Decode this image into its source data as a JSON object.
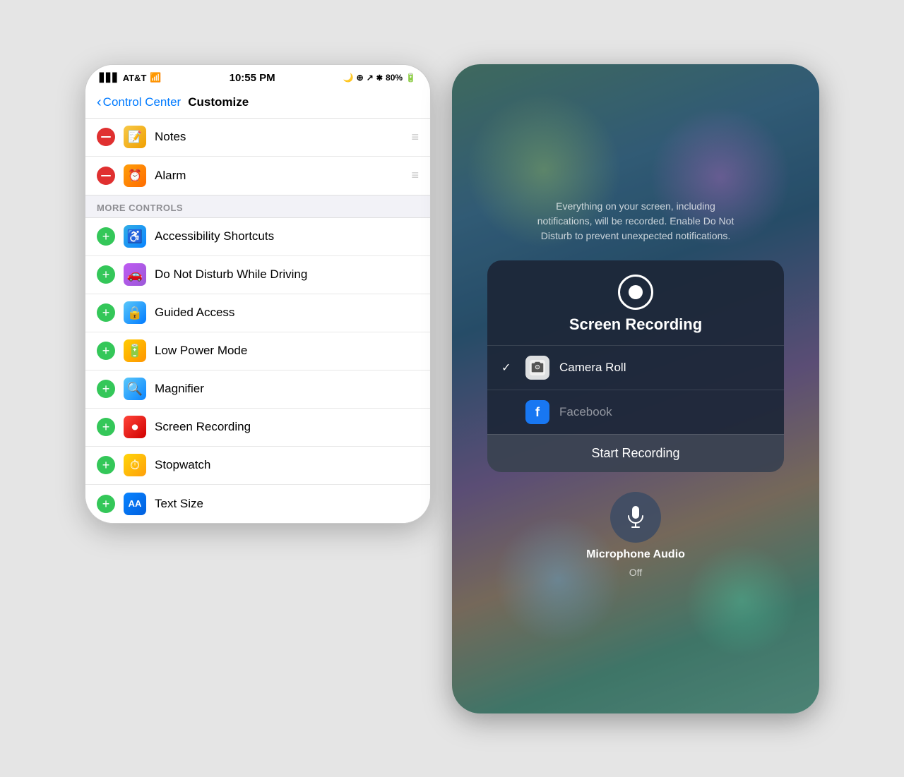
{
  "left_panel": {
    "status_bar": {
      "carrier": "AT&T",
      "time": "10:55 PM",
      "battery": "80%"
    },
    "nav": {
      "back_label": "Control Center",
      "title": "Customize"
    },
    "included_items": [
      {
        "id": "notes",
        "label": "Notes",
        "icon_class": "icon-yellow",
        "icon_char": "📝"
      },
      {
        "id": "alarm",
        "label": "Alarm",
        "icon_class": "icon-orange",
        "icon_char": "⏰"
      }
    ],
    "section_header": "MORE CONTROLS",
    "more_items": [
      {
        "id": "accessibility",
        "label": "Accessibility Shortcuts",
        "icon_class": "icon-blue",
        "icon_char": "♿"
      },
      {
        "id": "dnd-driving",
        "label": "Do Not Disturb While Driving",
        "icon_class": "icon-purple",
        "icon_char": "🚗"
      },
      {
        "id": "guided-access",
        "label": "Guided Access",
        "icon_class": "icon-blue-light",
        "icon_char": "🔒"
      },
      {
        "id": "low-power",
        "label": "Low Power Mode",
        "icon_class": "icon-orange2",
        "icon_char": "🔋"
      },
      {
        "id": "magnifier",
        "label": "Magnifier",
        "icon_class": "icon-blue2",
        "icon_char": "🔍"
      },
      {
        "id": "screen-recording",
        "label": "Screen Recording",
        "icon_class": "icon-red",
        "icon_char": "⏺"
      },
      {
        "id": "stopwatch",
        "label": "Stopwatch",
        "icon_class": "icon-orange3",
        "icon_char": "⏱"
      },
      {
        "id": "text-size",
        "label": "Text Size",
        "icon_class": "icon-blue3",
        "icon_char": "AA"
      }
    ]
  },
  "right_panel": {
    "description": "Everything on your screen, including notifications, will be recorded. Enable Do Not Disturb to prevent unexpected notifications.",
    "popup": {
      "title": "Screen Recording",
      "options": [
        {
          "id": "camera-roll",
          "label": "Camera Roll",
          "checked": true
        },
        {
          "id": "facebook",
          "label": "Facebook",
          "checked": false
        }
      ],
      "start_button": "Start Recording"
    },
    "microphone": {
      "label": "Microphone Audio",
      "sublabel": "Off"
    }
  }
}
